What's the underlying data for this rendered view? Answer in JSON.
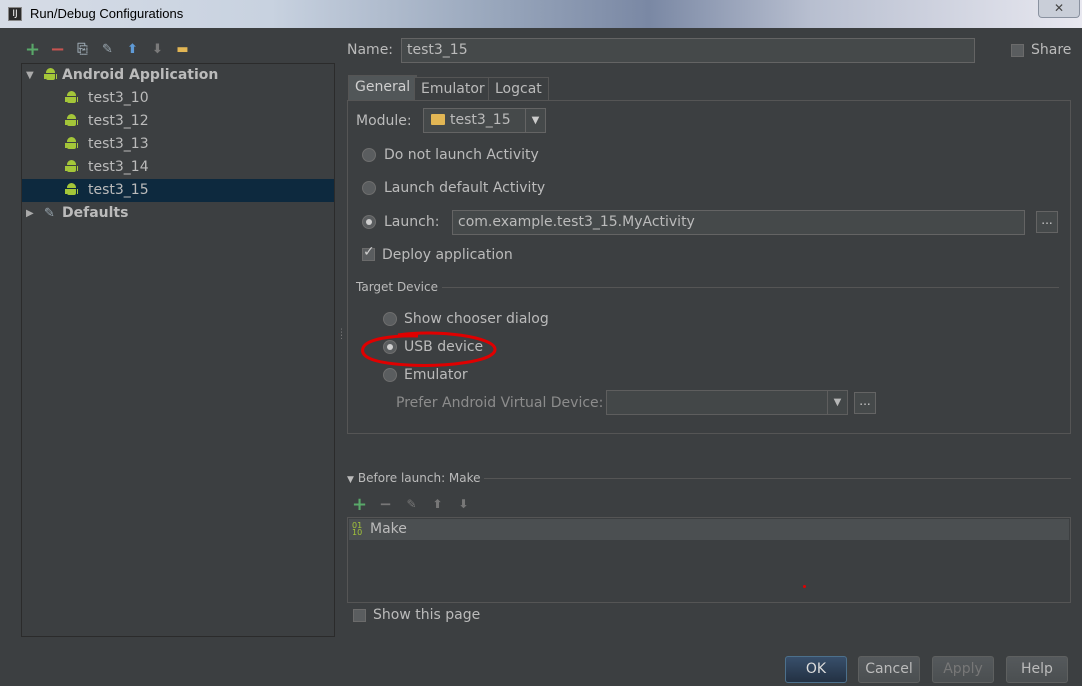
{
  "window": {
    "title": "Run/Debug Configurations",
    "close_label": "✕"
  },
  "left_toolbar": {
    "add": "+",
    "remove": "−",
    "copy": "⎘",
    "edit_defaults": "✎",
    "move_up": "⬆",
    "move_down": "⬇",
    "folder": "▬"
  },
  "tree": {
    "group_android": "Android Application",
    "items": [
      "test3_10",
      "test3_12",
      "test3_13",
      "test3_14",
      "test3_15"
    ],
    "selected": "test3_15",
    "group_defaults": "Defaults"
  },
  "name_label": "Name:",
  "name_value": "test3_15",
  "share_label": "Share",
  "tabs": [
    "General",
    "Emulator",
    "Logcat"
  ],
  "module": {
    "label": "Module:",
    "value": "test3_15"
  },
  "activity": {
    "options": [
      "Do not launch Activity",
      "Launch default Activity",
      "Launch:"
    ],
    "selected_index": 2,
    "launch_value": "com.example.test3_15.MyActivity",
    "browse_label": "..."
  },
  "deploy": {
    "label": "Deploy application",
    "checked": true
  },
  "target_device": {
    "section_label": "Target Device",
    "options": [
      "Show chooser dialog",
      "USB device",
      "Emulator"
    ],
    "selected_index": 1,
    "avd_label": "Prefer Android Virtual Device:",
    "avd_value": "",
    "avd_browse": "..."
  },
  "before_launch": {
    "header": "Before launch: Make",
    "toolbar": {
      "add": "+",
      "remove": "−",
      "edit": "✎",
      "up": "⬆",
      "down": "⬇"
    },
    "items": [
      "Make"
    ]
  },
  "show_page": {
    "label": "Show this page",
    "checked": false
  },
  "buttons": {
    "ok": "OK",
    "cancel": "Cancel",
    "apply": "Apply",
    "help": "Help"
  },
  "colors": {
    "background": "#3c3f41",
    "selection": "#0d293e",
    "annotation": "#e00000",
    "android_green": "#a4c639"
  }
}
